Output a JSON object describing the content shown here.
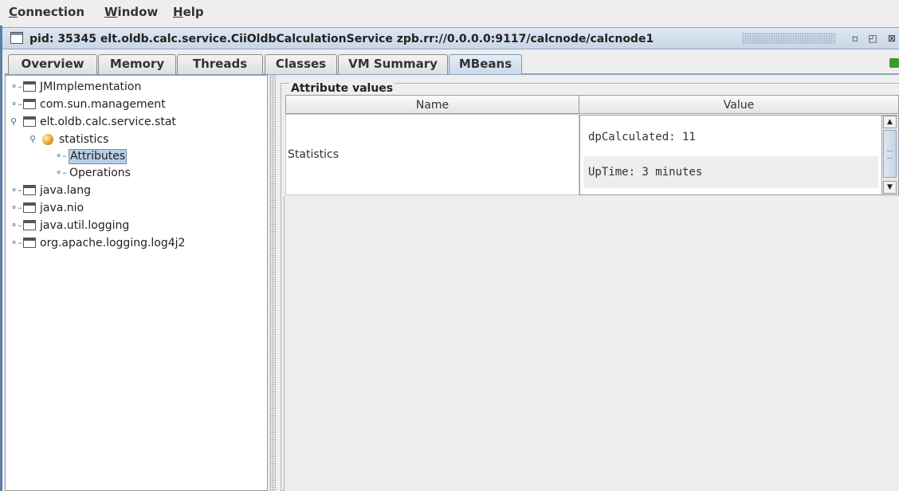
{
  "menu": {
    "items": [
      {
        "mnemonic": "C",
        "rest": "onnection"
      },
      {
        "mnemonic": "W",
        "rest": "indow"
      },
      {
        "mnemonic": "H",
        "rest": "elp"
      }
    ]
  },
  "frame": {
    "title": "pid: 35345 elt.oldb.calc.service.CiiOldbCalculationService zpb.rr://0.0.0.0:9117/calcnode/calcnode1"
  },
  "tabs": [
    "Overview",
    "Memory",
    "Threads",
    "Classes",
    "VM Summary",
    "MBeans"
  ],
  "active_tab": "MBeans",
  "tree": {
    "nodes": [
      {
        "label": "JMImplementation",
        "type": "folder",
        "expanded": false
      },
      {
        "label": "com.sun.management",
        "type": "folder",
        "expanded": false
      },
      {
        "label": "elt.oldb.calc.service.stat",
        "type": "folder",
        "expanded": true
      },
      {
        "label": "statistics",
        "type": "bean",
        "expanded": true
      },
      {
        "label": "Attributes",
        "type": "leaf",
        "selected": true
      },
      {
        "label": "Operations",
        "type": "leaf"
      },
      {
        "label": "java.lang",
        "type": "folder",
        "expanded": false
      },
      {
        "label": "java.nio",
        "type": "folder",
        "expanded": false
      },
      {
        "label": "java.util.logging",
        "type": "folder",
        "expanded": false
      },
      {
        "label": "org.apache.logging.log4j2",
        "type": "folder",
        "expanded": false
      }
    ]
  },
  "attributes": {
    "group_title": "Attribute values",
    "columns": [
      "Name",
      "Value"
    ],
    "row": {
      "name": "Statistics",
      "values": [
        "dpCalculated: 11",
        "UpTime: 3 minutes"
      ]
    }
  },
  "colors": {
    "title_bar": "#c8d6e6",
    "selection": "#b8cfe5",
    "accent_green": "#3a9a2a"
  }
}
